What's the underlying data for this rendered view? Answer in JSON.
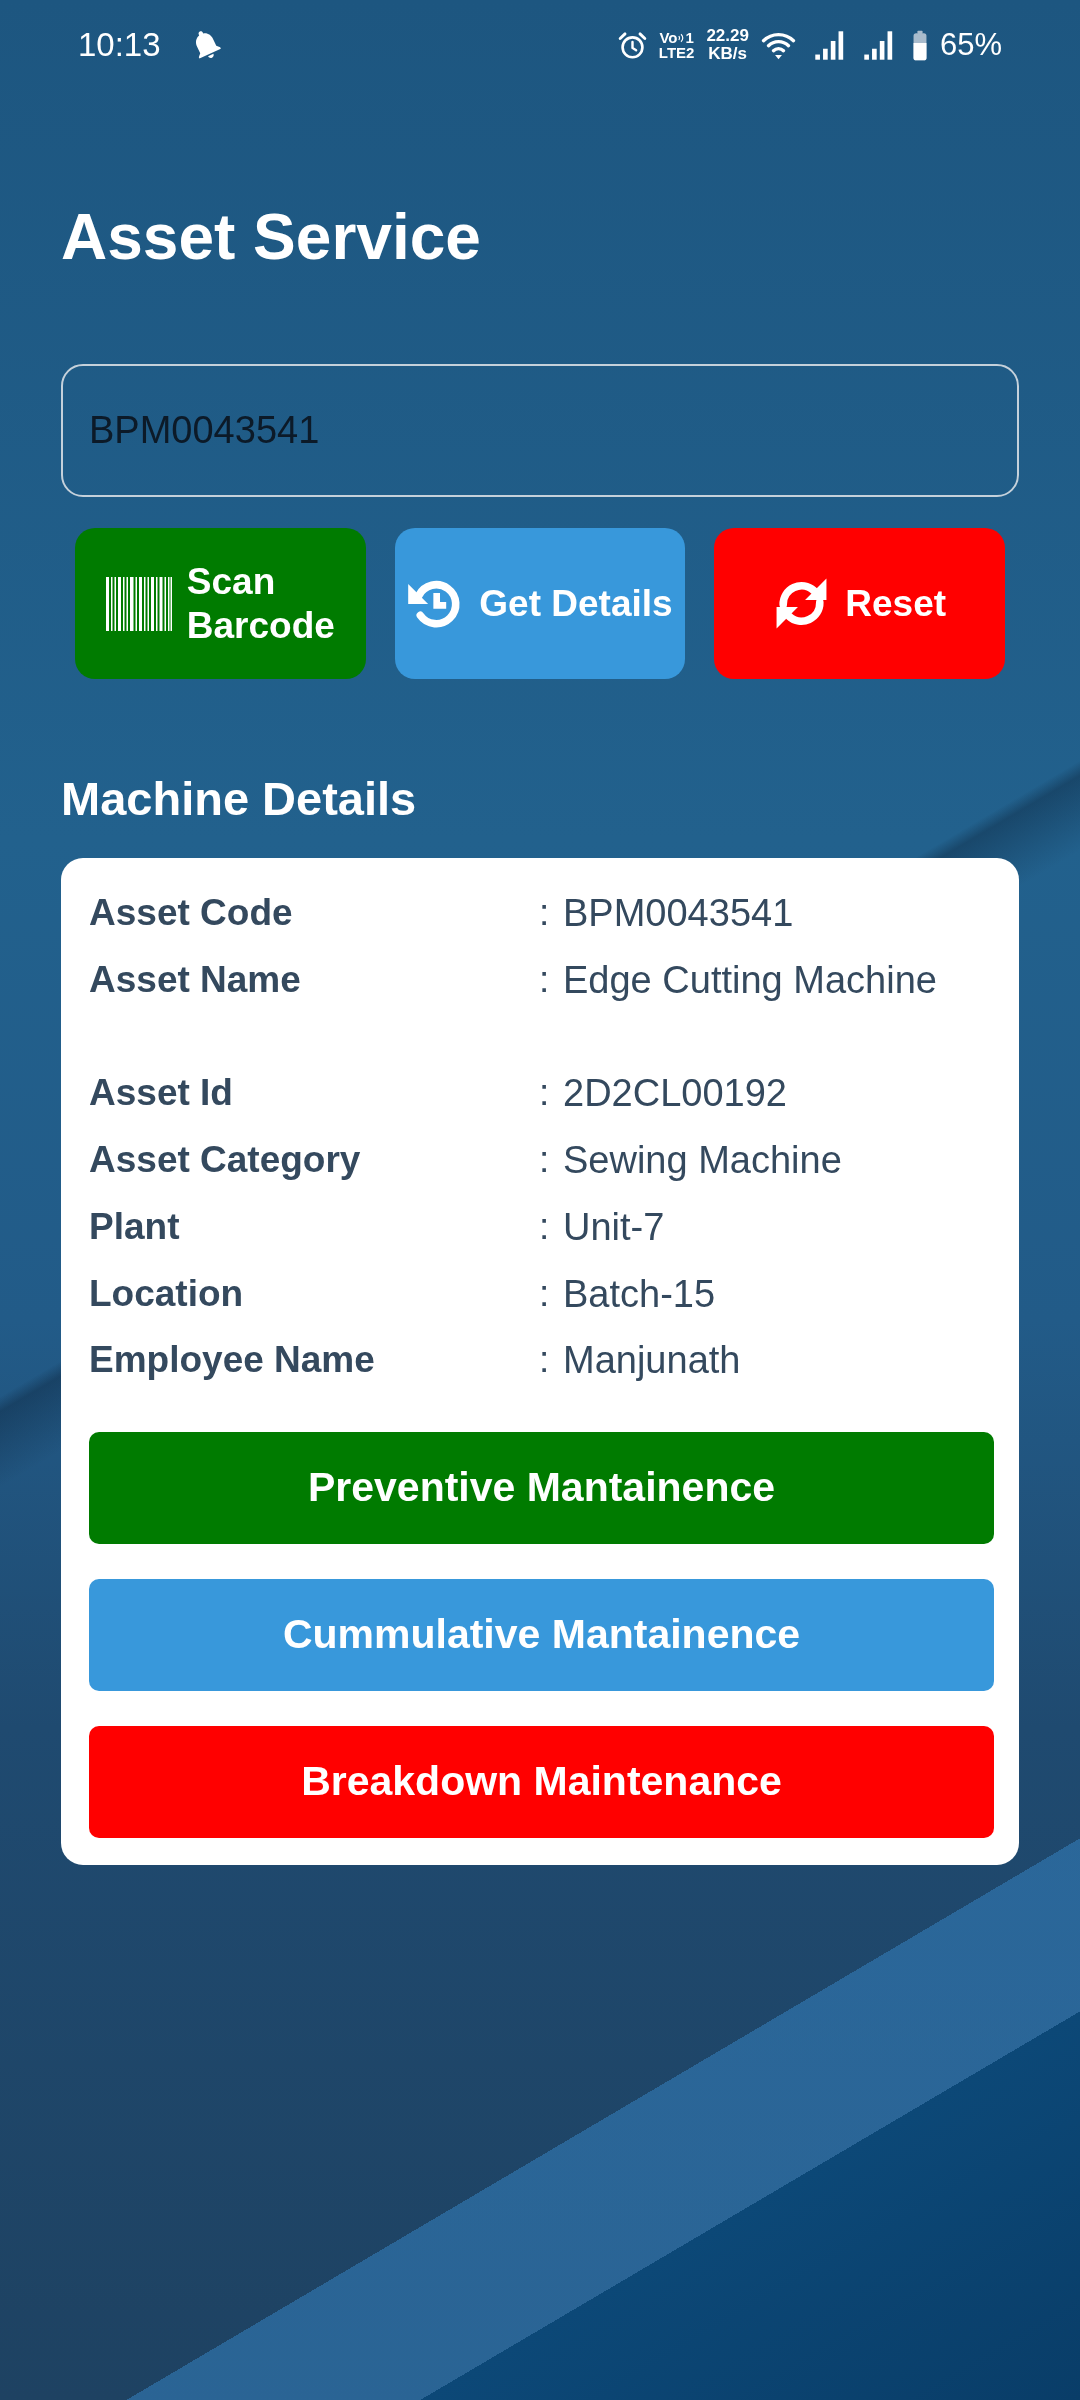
{
  "status_bar": {
    "time": "10:13",
    "volte_label": "Vo",
    "sim_slot": "1",
    "network_type": "LTE2",
    "speed_value": "22.29",
    "speed_unit": "KB/s",
    "battery": "65%"
  },
  "title": "Asset Service",
  "asset_field": {
    "value": "BPM0043541"
  },
  "actions": [
    {
      "kind": "scan",
      "label": "Scan Barcode",
      "color": "#007b00"
    },
    {
      "kind": "history",
      "label": "Get Details",
      "color": "#3898db"
    },
    {
      "kind": "reset",
      "label": "Reset",
      "color": "#ff0000"
    }
  ],
  "machine_details": {
    "title": "Machine Details",
    "groups": [
      {
        "rows": [
          {
            "label": "Asset Code",
            "separator": ":",
            "value": "BPM0043541"
          },
          {
            "label": "Asset Name",
            "separator": ":",
            "value": "Edge Cutting Machine"
          }
        ]
      },
      {
        "rows": [
          {
            "label": "Asset Id",
            "separator": ":",
            "value": "2D2CL00192"
          },
          {
            "label": "Asset Category",
            "separator": ":",
            "value": "Sewing Machine"
          },
          {
            "label": "Plant",
            "separator": ":",
            "value": "Unit-7"
          },
          {
            "label": "Location",
            "separator": ":",
            "value": "Batch-15"
          },
          {
            "label": "Employee Name",
            "separator": ":",
            "value": "Manjunath"
          }
        ]
      }
    ],
    "buttons": [
      {
        "label": "Preventive Mantainence",
        "color": "#007b00"
      },
      {
        "label": "Cummulative Mantainence",
        "color": "#3898db"
      },
      {
        "label": "Breakdown Maintenance",
        "color": "#ff0000"
      }
    ]
  }
}
